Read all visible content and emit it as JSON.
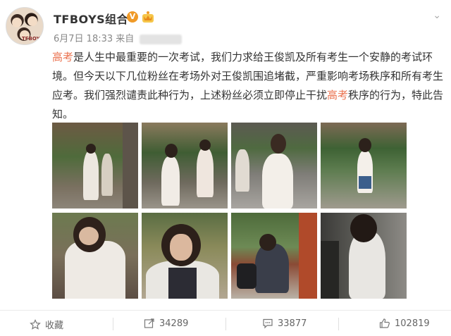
{
  "post": {
    "username": "TFBOYS组合",
    "verified_badge": "V",
    "date": "6月7日 18:33",
    "source_prefix": "来自",
    "avatar_caption": "TFBOYS",
    "text": {
      "hl_1": "高考",
      "part_1": "是人生中最重要的一次考试，我们力求给王俊凯及所有考生一个安静的考试环境。但今天以下几位粉丝在考场外对王俊凯围追堵截，严重影响考场秩序和所有考生应考。我们强烈谴责此种行为，上述粉丝必须立即停止干扰",
      "hl_2": "高考",
      "part_2": "秩序的行为，特此告知。"
    }
  },
  "actions": {
    "favorite_label": "收藏",
    "repost_count": "34289",
    "comment_count": "33877",
    "like_count": "102819"
  },
  "colors": {
    "highlight": "#eb7350",
    "badge": "#f09a28"
  }
}
